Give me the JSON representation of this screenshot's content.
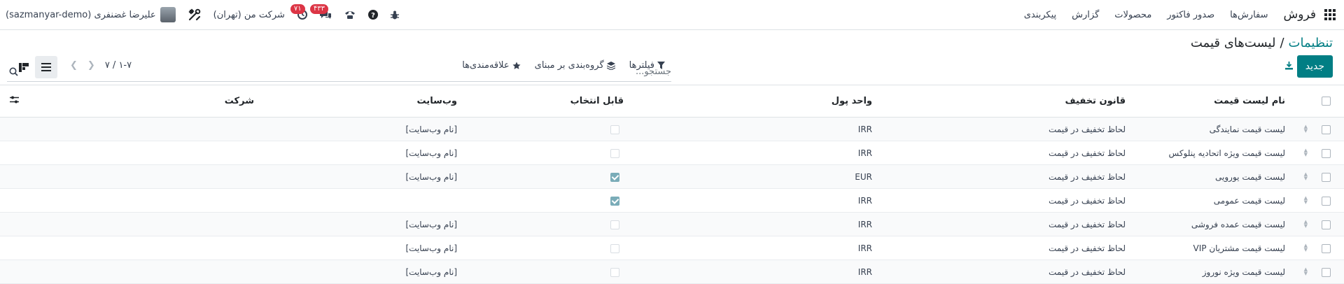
{
  "navbar": {
    "brand": "فروش",
    "menu": [
      "سفارش‌ها",
      "صدور فاکتور",
      "محصولات",
      "گزارش",
      "پیکربندی"
    ],
    "badges": {
      "messages": "۴۳۳",
      "activities": "۷۱"
    },
    "company": "شرکت من (تهران)",
    "user": "علیرضا غضنفری (sazmanyar-demo)"
  },
  "breadcrumb": {
    "parent": "تنظیمات",
    "separator": "/",
    "current": "لیست‌های قیمت"
  },
  "search": {
    "placeholder": "جستجو..."
  },
  "actions": {
    "new": "جدید"
  },
  "filters": {
    "filters": "فیلترها",
    "group_by": "گروه‌بندی بر مبنای",
    "favorites": "علاقه‌مندی‌ها"
  },
  "pager": {
    "text": "۱-۷ / ۷"
  },
  "table": {
    "headers": {
      "name": "نام لیست قیمت",
      "discount": "قانون تخفیف",
      "currency": "واحد پول",
      "selectable": "قابل انتخاب",
      "website": "وب‌سایت",
      "company": "شرکت"
    },
    "rows": [
      {
        "name": "لیست قیمت نمایندگی",
        "discount": "لحاظ تخفیف در قیمت",
        "currency": "IRR",
        "selectable": false,
        "website": "[نام وب‌سایت]",
        "company": ""
      },
      {
        "name": "لیست قیمت ویژه اتحادیه پنلوکس",
        "discount": "لحاظ تخفیف در قیمت",
        "currency": "IRR",
        "selectable": false,
        "website": "[نام وب‌سایت]",
        "company": ""
      },
      {
        "name": "لیست قیمت یورویی",
        "discount": "لحاظ تخفیف در قیمت",
        "currency": "EUR",
        "selectable": true,
        "website": "[نام وب‌سایت]",
        "company": ""
      },
      {
        "name": "لیست قیمت عمومی",
        "discount": "لحاظ تخفیف در قیمت",
        "currency": "IRR",
        "selectable": true,
        "website": "",
        "company": ""
      },
      {
        "name": "لیست قیمت عمده فروشی",
        "discount": "لحاظ تخفیف در قیمت",
        "currency": "IRR",
        "selectable": false,
        "website": "[نام وب‌سایت]",
        "company": ""
      },
      {
        "name": "لیست قیمت مشتریان VIP",
        "discount": "لحاظ تخفیف در قیمت",
        "currency": "IRR",
        "selectable": false,
        "website": "[نام وب‌سایت]",
        "company": ""
      },
      {
        "name": "لیست قیمت ویژه نوروز",
        "discount": "لحاظ تخفیف در قیمت",
        "currency": "IRR",
        "selectable": false,
        "website": "[نام وب‌سایت]",
        "company": ""
      }
    ]
  },
  "colors": {
    "accent": "#017e84",
    "badge": "#dc3545"
  }
}
